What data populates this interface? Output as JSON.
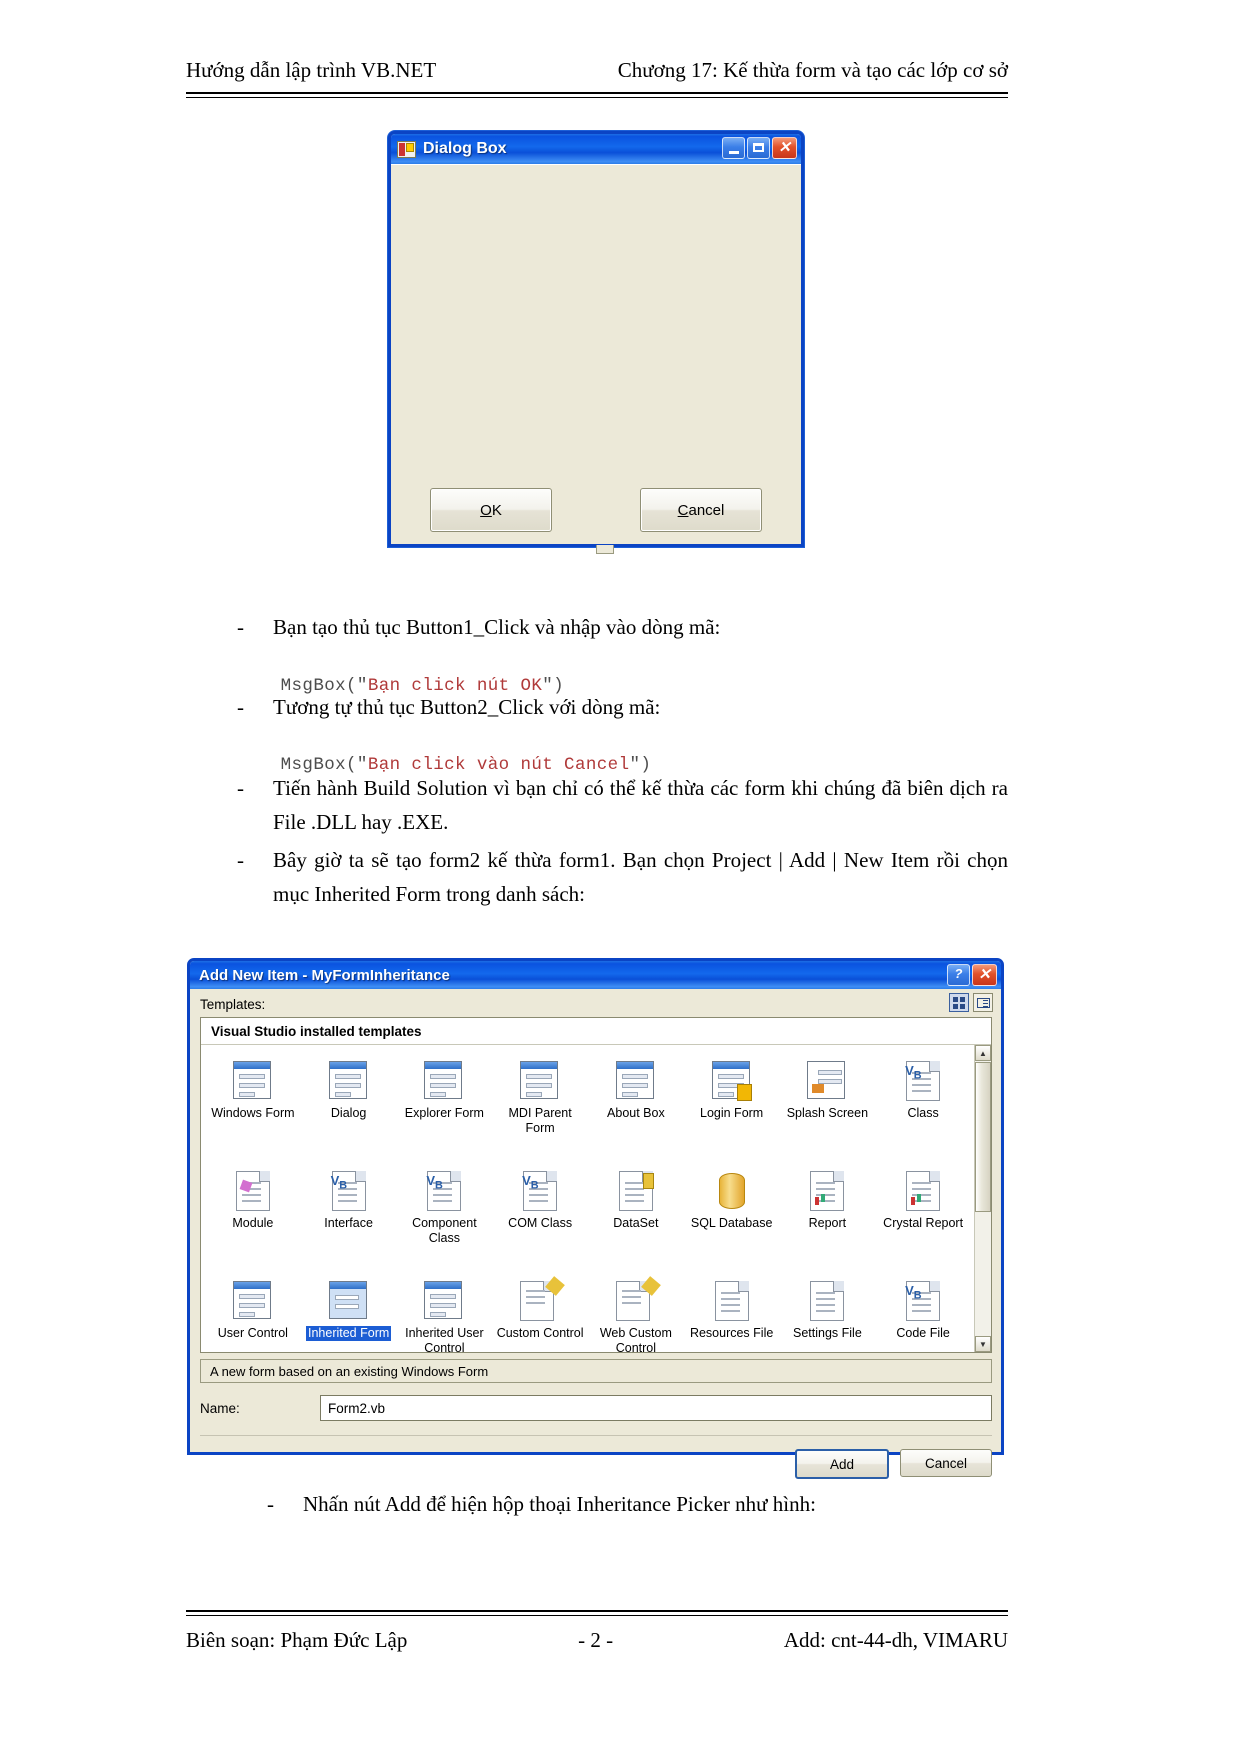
{
  "header": {
    "left": "Hướng dẫn lập trình VB.NET",
    "right": "Chương 17: Kế thừa form và tạo các lớp cơ sở"
  },
  "footer": {
    "left": "Biên soạn: Phạm Đức Lập",
    "center": "- 2 -",
    "right": "Add: cnt-44-dh, VIMARU"
  },
  "dialog_box_window": {
    "title": "Dialog Box",
    "icon": "vb-form-icon",
    "minimize_label": "_",
    "maximize_label": "□",
    "close_label": "✕",
    "buttons": [
      {
        "name": "ok",
        "label_prefix": "",
        "accel": "O",
        "label_rest": "K"
      },
      {
        "name": "cancel",
        "label_prefix": "",
        "accel": "C",
        "label_rest": "ancel"
      }
    ]
  },
  "body": {
    "bullet_dash": "-",
    "items": [
      {
        "type": "bullet",
        "text": "Bạn tạo thủ tục Button1_Click và nhập vào dòng mã:"
      },
      {
        "type": "code",
        "pre": "MsgBox(\"",
        "str": "Bạn click nút OK",
        "post": "\")"
      },
      {
        "type": "bullet",
        "text": "Tương tự thủ tục Button2_Click với dòng mã:"
      },
      {
        "type": "code",
        "pre": "MsgBox(\"",
        "str": "Bạn click vào nút Cancel",
        "post": "\")"
      },
      {
        "type": "bullet",
        "text": "Tiến hành Build Solution vì bạn chỉ có thể kế thừa các form khi chúng đã biên dịch ra File .DLL hay .EXE."
      },
      {
        "type": "bullet",
        "text": "Bây giờ ta sẽ tạo form2 kế thừa form1. Bạn chọn Project | Add | New Item rồi chọn mục Inherited Form trong danh sách:"
      },
      {
        "type": "bullet",
        "text": "Nhấn nút Add để hiện hộp thoại Inheritance Picker như hình:"
      }
    ],
    "code_1_line": "MsgBox(\"Bạn click nút OK\")",
    "code_2_line": "MsgBox(\"Bạn click vào nút Cancel\")"
  },
  "add_new_item_window": {
    "title": "Add New Item - MyFormInheritance",
    "help_label": "?",
    "close_label": "✕",
    "templates_label": "Templates:",
    "view_large_icons": "large-icons-view",
    "view_list": "list-view",
    "group_header": "Visual Studio installed templates",
    "templates": [
      {
        "label": "Windows Form",
        "icon": "windows-form-icon",
        "selected": false
      },
      {
        "label": "Dialog",
        "icon": "dialog-icon",
        "selected": false
      },
      {
        "label": "Explorer Form",
        "icon": "explorer-form-icon",
        "selected": false
      },
      {
        "label": "MDI Parent Form",
        "icon": "mdi-parent-form-icon",
        "selected": false
      },
      {
        "label": "About Box",
        "icon": "about-box-icon",
        "selected": false
      },
      {
        "label": "Login Form",
        "icon": "login-form-icon",
        "selected": false
      },
      {
        "label": "Splash Screen",
        "icon": "splash-screen-icon",
        "selected": false
      },
      {
        "label": "Class",
        "icon": "class-icon",
        "selected": false
      },
      {
        "label": "Module",
        "icon": "module-icon",
        "selected": false
      },
      {
        "label": "Interface",
        "icon": "interface-icon",
        "selected": false
      },
      {
        "label": "Component Class",
        "icon": "component-class-icon",
        "selected": false
      },
      {
        "label": "COM Class",
        "icon": "com-class-icon",
        "selected": false
      },
      {
        "label": "DataSet",
        "icon": "dataset-icon",
        "selected": false
      },
      {
        "label": "SQL Database",
        "icon": "sql-database-icon",
        "selected": false
      },
      {
        "label": "Report",
        "icon": "report-icon",
        "selected": false
      },
      {
        "label": "Crystal Report",
        "icon": "crystal-report-icon",
        "selected": false
      },
      {
        "label": "User Control",
        "icon": "user-control-icon",
        "selected": false
      },
      {
        "label": "Inherited Form",
        "icon": "inherited-form-icon",
        "selected": true
      },
      {
        "label": "Inherited User Control",
        "icon": "inherited-user-control-icon",
        "selected": false
      },
      {
        "label": "Custom Control",
        "icon": "custom-control-icon",
        "selected": false
      },
      {
        "label": "Web Custom Control",
        "icon": "web-custom-control-icon",
        "selected": false
      },
      {
        "label": "Resources File",
        "icon": "resources-file-icon",
        "selected": false
      },
      {
        "label": "Settings File",
        "icon": "settings-file-icon",
        "selected": false
      },
      {
        "label": "Code File",
        "icon": "code-file-icon",
        "selected": false
      }
    ],
    "description": "A new form based on an existing Windows Form",
    "name_label": "Name:",
    "name_value": "Form2.vb",
    "add_button": "Add",
    "cancel_button": "Cancel",
    "scroll_up": "▲",
    "scroll_down": "▼"
  },
  "colors": {
    "title_bar_blue": "#0a53e0",
    "window_border": "#0b44c4",
    "dialog_face": "#ece9d8",
    "selection_blue": "#1c5dd4",
    "code_string_red": "#b03a3a"
  }
}
